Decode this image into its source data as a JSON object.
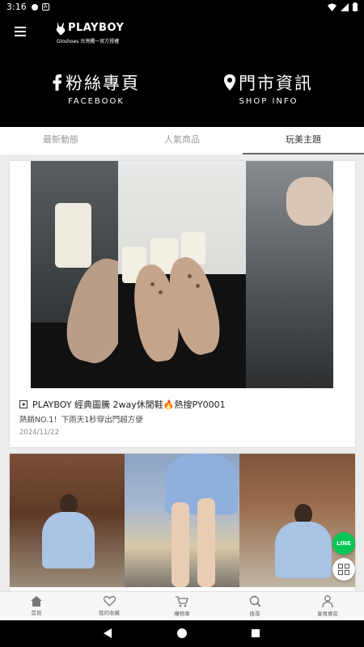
{
  "status_bar": {
    "time": "3:16"
  },
  "header": {
    "logo_brand": "PLAYBOY",
    "logo_sub": "Gloshoes 台灣獨一官方授權",
    "facebook_main": "粉絲專頁",
    "facebook_en": "FACEBOOK",
    "shop_main": "門市資訊",
    "shop_en": "SHOP INFO"
  },
  "tabs": [
    {
      "label": "最新動態",
      "active": false
    },
    {
      "label": "人氣商品",
      "active": false
    },
    {
      "label": "玩美主題",
      "active": true
    }
  ],
  "posts": [
    {
      "title": "PLAYBOY 經典圖騰 2way休閒鞋🔥熱搜PY0001",
      "description": "熱銷NO.1！下雨天1秒穿出門超方便",
      "date": "2024/11/22"
    }
  ],
  "floating": {
    "line_label": "LINE"
  },
  "bottom_nav": [
    {
      "label": "首頁",
      "icon": "home-icon"
    },
    {
      "label": "我的收藏",
      "icon": "heart-icon"
    },
    {
      "label": "購物車",
      "icon": "cart-icon"
    },
    {
      "label": "搜尋",
      "icon": "search-icon"
    },
    {
      "label": "會員專區",
      "icon": "user-icon"
    }
  ],
  "colors": {
    "header_bg": "#000000",
    "line_green": "#06c755",
    "tab_active": "#333333"
  }
}
